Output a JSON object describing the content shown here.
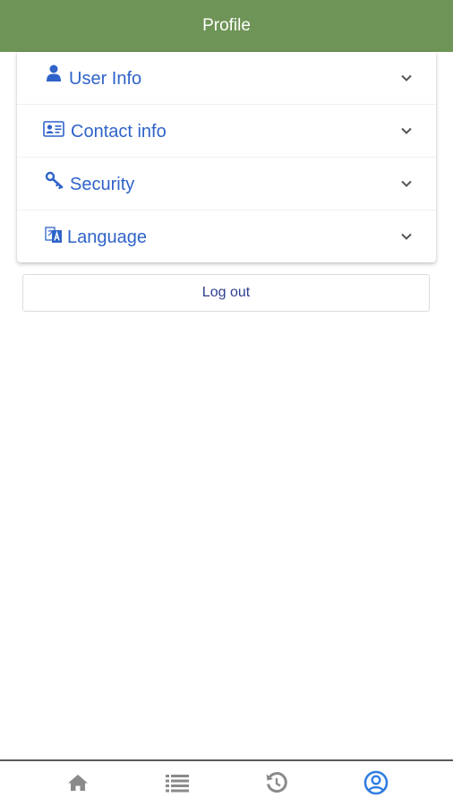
{
  "header": {
    "title": "Profile"
  },
  "accordion": {
    "items": [
      {
        "label": "User Info",
        "icon": "user-icon"
      },
      {
        "label": "Contact info",
        "icon": "id-card-icon"
      },
      {
        "label": "Security",
        "icon": "key-icon"
      },
      {
        "label": "Language",
        "icon": "translate-icon"
      }
    ]
  },
  "logout_label": "Log out",
  "tabbar": {
    "tabs": [
      {
        "icon": "home-icon",
        "active": false
      },
      {
        "icon": "list-icon",
        "active": false
      },
      {
        "icon": "history-icon",
        "active": false
      },
      {
        "icon": "account-icon",
        "active": true
      }
    ]
  },
  "colors": {
    "header": "#6f9457",
    "accent": "#2f63c9",
    "logout_text": "#2d3f8f",
    "tab_inactive": "#8a8a8a",
    "tab_active": "#2f7de1"
  }
}
